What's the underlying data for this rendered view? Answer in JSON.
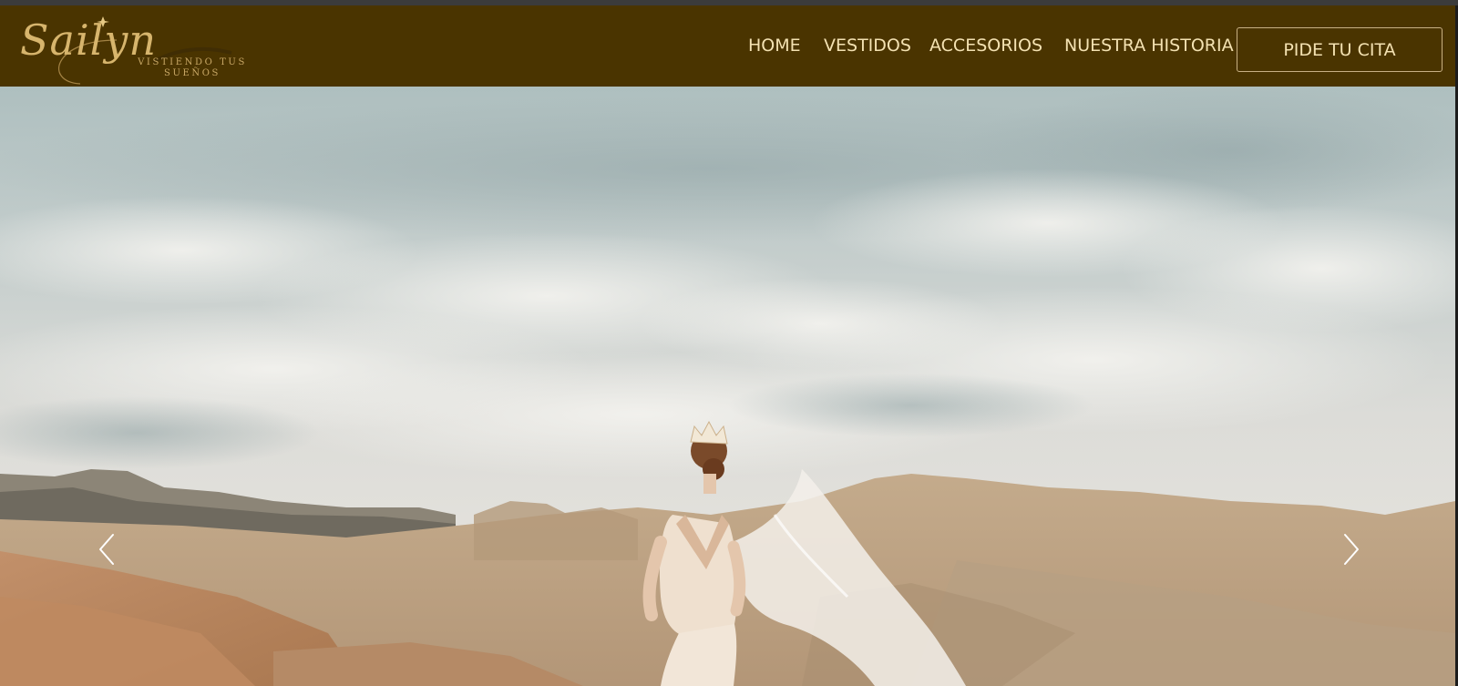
{
  "brand": {
    "logo_script": "Sailyn",
    "tagline": "VISTIENDO TUS SUEÑOS"
  },
  "nav": {
    "items": [
      {
        "label": "HOME"
      },
      {
        "label": "VESTIDOS"
      },
      {
        "label": "ACCESORIOS"
      },
      {
        "label": "NUESTRA HISTORIA"
      }
    ],
    "cta_label": "PIDE TU CITA"
  },
  "hero": {
    "image": "bride-in-desert-photo",
    "prev_icon": "chevron-left-icon",
    "next_icon": "chevron-right-icon"
  },
  "colors": {
    "header_bg": "#4a3400",
    "nav_text": "#f4e2b2",
    "logo_gold": "#d7b56d"
  }
}
